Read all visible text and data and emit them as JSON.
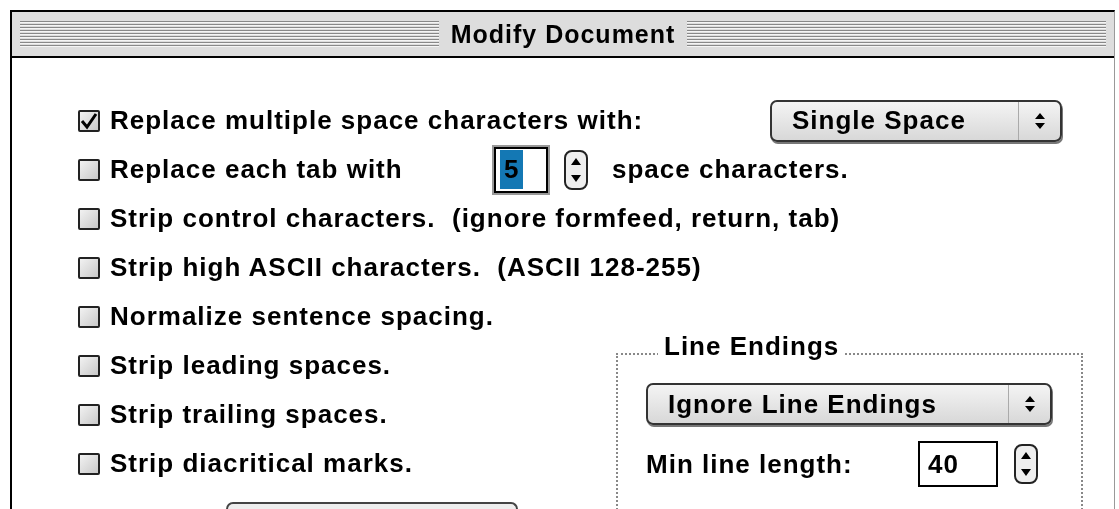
{
  "window": {
    "title": "Modify Document"
  },
  "options": [
    {
      "kind": "popup",
      "label": "Replace multiple space characters with:",
      "checked": true,
      "value": "Single Space"
    },
    {
      "kind": "stepper",
      "label": "Replace each tab with",
      "checked": false,
      "value": "5",
      "selected": true,
      "suffix": "space characters."
    },
    {
      "kind": "plain",
      "label": "Strip control characters.  (ignore formfeed, return, tab)",
      "checked": false
    },
    {
      "kind": "plain",
      "label": "Strip high ASCII characters.  (ASCII 128-255)",
      "checked": false
    },
    {
      "kind": "plain",
      "label": "Normalize sentence spacing.",
      "checked": false
    },
    {
      "kind": "plain",
      "label": "Strip leading spaces.",
      "checked": false
    },
    {
      "kind": "plain",
      "label": "Strip trailing spaces.",
      "checked": false
    },
    {
      "kind": "plain",
      "label": "Strip diacritical marks.",
      "checked": false
    }
  ],
  "line_endings": {
    "title": "Line Endings",
    "mode": "Ignore Line Endings",
    "min_length_label": "Min line length:",
    "min_length": "40"
  }
}
